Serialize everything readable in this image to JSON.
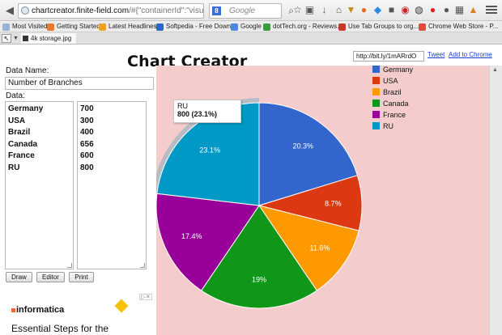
{
  "browser": {
    "url_host": "chartcreator.finite-field.com",
    "url_rest": "/#{\"containerId\":\"visualiza",
    "search_engine": "Google",
    "search_placeholder": "Google",
    "bookmarks": [
      {
        "label": "Most Visited",
        "color": "#9ab0d6"
      },
      {
        "label": "Getting Started",
        "color": "#e57a2f"
      },
      {
        "label": "Latest Headlines",
        "color": "#f0a024"
      },
      {
        "label": "Softpedia - Free Downl...",
        "color": "#2b66c9"
      },
      {
        "label": "Google",
        "color": "#4f86e0"
      },
      {
        "label": "dotTech.org - Reviews...",
        "color": "#3b9c3b"
      },
      {
        "label": "Use Tab Groups to org...",
        "color": "#c43a2b"
      },
      {
        "label": "Chrome Web Store - P...",
        "color": "#e04a3a"
      }
    ],
    "tab_title": "4k storage.jpg"
  },
  "page": {
    "title": "Chart Creator",
    "short_url": "http://bit.ly/1mARrdO",
    "tweet_label": "Tweet",
    "add_chrome_label": "Add to Chrome",
    "name_label": "Data Name:",
    "name_value": "Number of Branches",
    "data_label": "Data:",
    "countries_text": "Germany\nUSA\nBrazil\nCanada\nFrance\nRU",
    "values_text": "700\n300\n400\n656\n600\n800",
    "buttons": {
      "draw": "Draw",
      "editor": "Editor",
      "print": "Print"
    },
    "ad": {
      "brand": "informatica",
      "headline": "Essential Steps for the"
    }
  },
  "tooltip": {
    "label": "RU",
    "value": "800 (23.1%)"
  },
  "chart_data": {
    "type": "pie",
    "title": "",
    "categories": [
      "Germany",
      "USA",
      "Brazil",
      "Canada",
      "France",
      "RU"
    ],
    "values": [
      700,
      300,
      400,
      656,
      600,
      800
    ],
    "percent_labels": [
      "20.3%",
      "8.7%",
      "11.6%",
      "19%",
      "17.4%",
      "23.1%"
    ],
    "colors": [
      "#3366cc",
      "#dc3912",
      "#ff9900",
      "#109618",
      "#990099",
      "#0099c6"
    ],
    "legend_position": "top-right",
    "highlighted": "RU"
  }
}
